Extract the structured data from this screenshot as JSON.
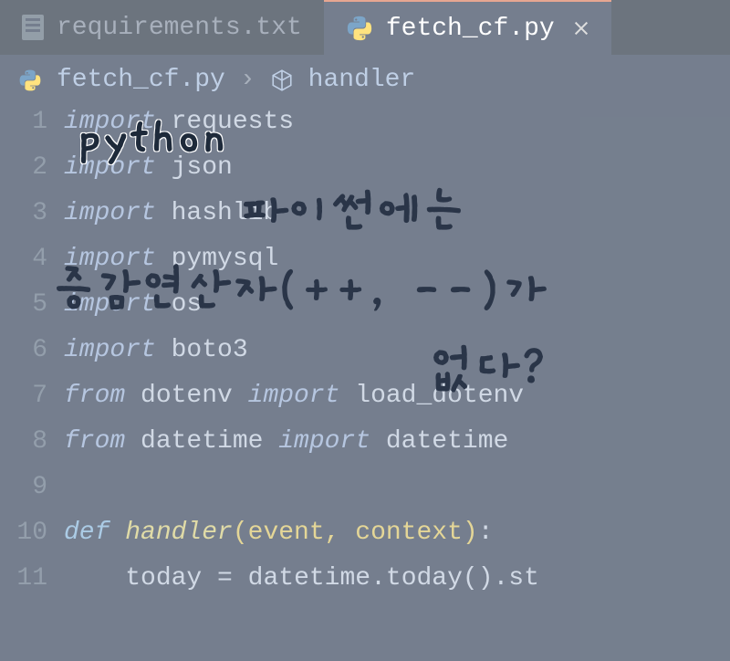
{
  "tabs": [
    {
      "label": "requirements.txt",
      "active": false
    },
    {
      "label": "fetch_cf.py",
      "active": true
    }
  ],
  "breadcrumbs": {
    "file": "fetch_cf.py",
    "symbol": "handler"
  },
  "gutter": [
    "1",
    "2",
    "3",
    "4",
    "5",
    "6",
    "7",
    "8",
    "9",
    "10",
    "11"
  ],
  "code": {
    "l1": {
      "kw": "import",
      "rest": " requests"
    },
    "l2": {
      "kw": "import",
      "rest": " json"
    },
    "l3": {
      "kw": "import",
      "rest": " hashlib"
    },
    "l4": {
      "kw": "import",
      "rest": " pymysql"
    },
    "l5": {
      "kw": "import",
      "rest": " os"
    },
    "l6": {
      "kw": "import",
      "rest": " boto3"
    },
    "l7": {
      "kw1": "from",
      "mod": " dotenv ",
      "kw2": "import",
      "rest": " load_dotenv"
    },
    "l8": {
      "kw1": "from",
      "mod": " datetime ",
      "kw2": "import",
      "rest": " datetime"
    },
    "l10": {
      "kw": "def",
      "fn": " handler",
      "args": "(event, context)",
      "colon": ":"
    },
    "l11": {
      "indent": "    ",
      "lhs": "today ",
      "op": "=",
      "rhs": " datetime.today().st"
    }
  },
  "overlay": {
    "python": "python",
    "line1": "파이썬에는",
    "line2": "증감연산자(++, --)가",
    "line3": "없다?"
  }
}
